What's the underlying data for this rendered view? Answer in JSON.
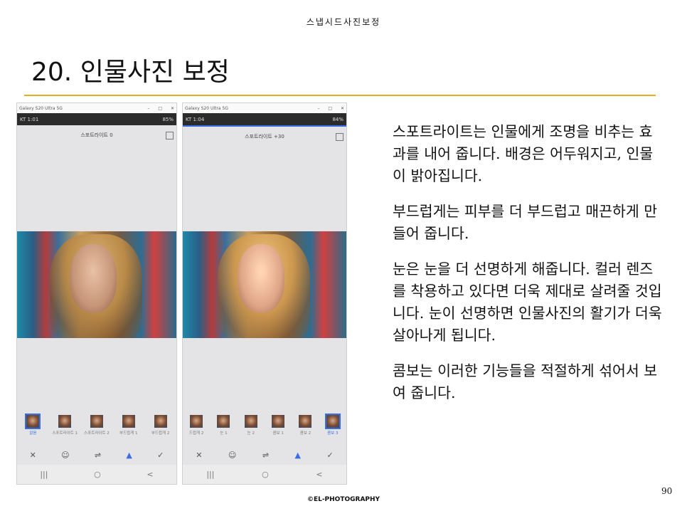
{
  "header": {
    "text": "스냅시드사진보정"
  },
  "title": "20. 인물사진 보정",
  "screenshots": [
    {
      "window_title": "Galaxy S20 Ultra 5G",
      "status_left": "KT 1:01",
      "status_right": "85%",
      "tool_label": "스포트라이트 0",
      "thumb_labels": [
        "없음",
        "스포트라이트 1",
        "스포트라이트 2",
        "부드럽게 1",
        "부드럽게 2"
      ],
      "selected_thumb": 0
    },
    {
      "window_title": "Galaxy S20 Ultra 5G",
      "status_left": "KT 1:04",
      "status_right": "84%",
      "tool_label": "스포트라이트 +30",
      "thumb_labels": [
        "드럽게 2",
        "눈 1",
        "눈 2",
        "콤보 1",
        "콤보 2",
        "콤보 3"
      ],
      "selected_thumb": 5
    }
  ],
  "window_controls": {
    "minimize": "–",
    "maximize": "□",
    "close": "✕"
  },
  "tools": {
    "cancel": "✕",
    "face": "☺",
    "adjust": "⇌",
    "style": "▲",
    "confirm": "✓"
  },
  "nav": {
    "recent": "|||",
    "home": "○",
    "back": "<"
  },
  "paragraphs": [
    "스포트라이트는 인물에게 조명을 비추는 효과를 내어 줍니다. 배경은 어두워지고, 인물이 밝아집니다.",
    "부드럽게는 피부를 더 부드럽고 매끈하게 만들어 줍니다.",
    "눈은 눈을 더 선명하게 해줍니다. 컬러 렌즈를 착용하고 있다면 더욱 제대로 살려줄 것입니다. 눈이 선명하면 인물사진의 활기가 더욱 살아나게 됩니다.",
    "콤보는 이러한 기능들을 적절하게 섞어서 보여 줍니다."
  ],
  "page_number": "90",
  "footer": "©EL-PHOTOGRAPHY",
  "colors": {
    "accent_rule": "#e0b020",
    "selection": "#3a6ee8"
  }
}
